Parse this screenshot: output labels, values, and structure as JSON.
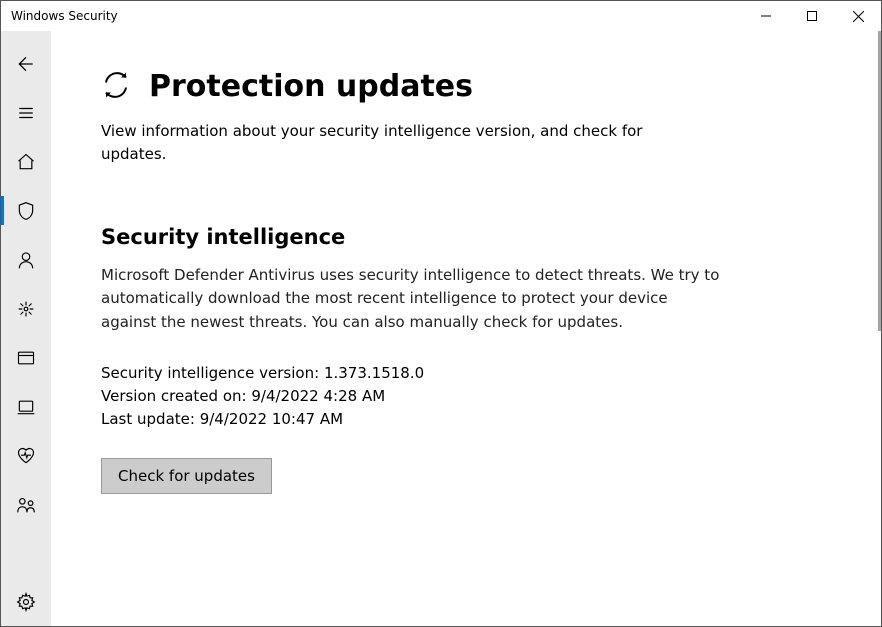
{
  "window": {
    "title": "Windows Security"
  },
  "sidebar": {
    "items": [
      {
        "name": "back-icon"
      },
      {
        "name": "menu-icon"
      },
      {
        "name": "home-icon"
      },
      {
        "name": "shield-icon",
        "active": true
      },
      {
        "name": "account-icon"
      },
      {
        "name": "firewall-icon"
      },
      {
        "name": "app-browser-icon"
      },
      {
        "name": "device-security-icon"
      },
      {
        "name": "health-icon"
      },
      {
        "name": "family-icon"
      }
    ],
    "footer": {
      "name": "settings-icon"
    }
  },
  "main": {
    "title": "Protection updates",
    "subtitle": "View information about your security intelligence version, and check for updates.",
    "section": {
      "heading": "Security intelligence",
      "body": "Microsoft Defender Antivirus uses security intelligence to detect threats. We try to automatically download the most recent intelligence to protect your device against the newest threats. You can also manually check for updates.",
      "version_label": "Security intelligence version:",
      "version_value": "1.373.1518.0",
      "created_label": "Version created on:",
      "created_value": "9/4/2022 4:28 AM",
      "last_update_label": "Last update:",
      "last_update_value": "9/4/2022 10:47 AM",
      "button": "Check for updates"
    }
  }
}
